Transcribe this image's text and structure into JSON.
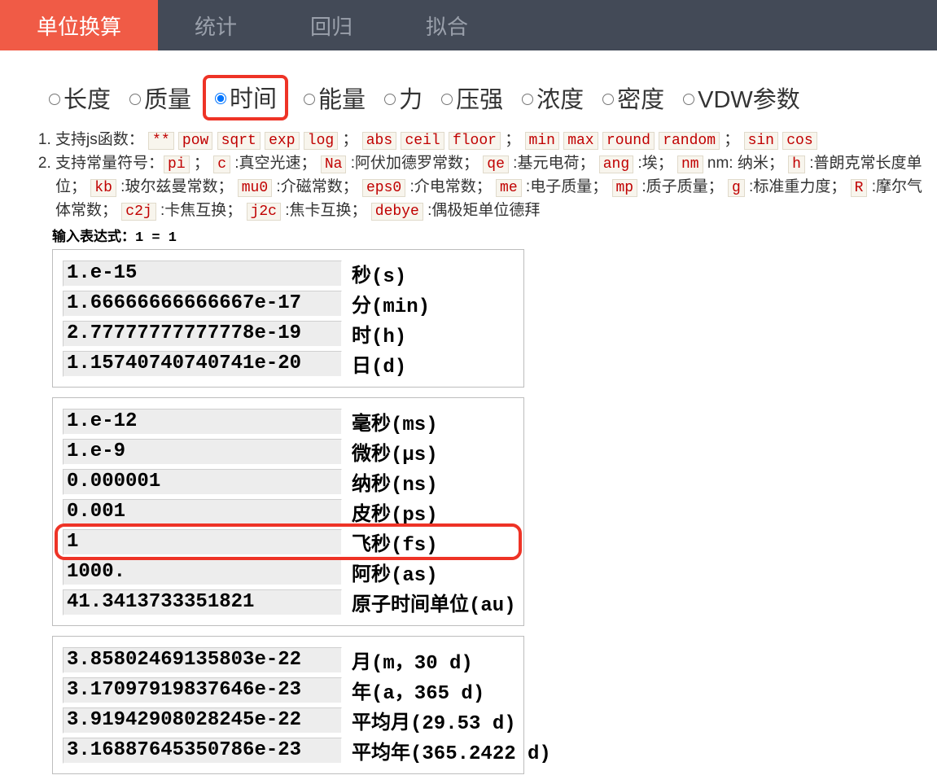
{
  "tabs": [
    {
      "label": "单位换算",
      "active": true
    },
    {
      "label": "统计",
      "active": false
    },
    {
      "label": "回归",
      "active": false
    },
    {
      "label": "拟合",
      "active": false
    }
  ],
  "categories": [
    {
      "label": "长度"
    },
    {
      "label": "质量"
    },
    {
      "label": "时间",
      "selected": true,
      "highlight": true
    },
    {
      "label": "能量"
    },
    {
      "label": "力"
    },
    {
      "label": "压强"
    },
    {
      "label": "浓度"
    },
    {
      "label": "密度"
    },
    {
      "label": "VDW参数"
    }
  ],
  "note1_prefix": "支持js函数：",
  "note1_funcs_a": [
    "**",
    "pow",
    "sqrt",
    "exp",
    "log"
  ],
  "note1_funcs_b": [
    "abs",
    "ceil",
    "floor"
  ],
  "note1_funcs_c": [
    "min",
    "max",
    "round",
    "random"
  ],
  "note1_funcs_d": [
    "sin",
    "cos"
  ],
  "note2_prefix": "支持常量符号：",
  "note2_items": [
    {
      "code": "pi",
      "text": "；"
    },
    {
      "code": "c",
      "text": ":真空光速；"
    },
    {
      "code": "Na",
      "text": ":阿伏加德罗常数；"
    },
    {
      "code": "qe",
      "text": ":基元电荷；"
    },
    {
      "code": "ang",
      "text": ":埃；"
    },
    {
      "code": "nm",
      "text": "nm: 纳米；"
    },
    {
      "code": "h",
      "text": ":普朗克常长度单位；"
    },
    {
      "code": "kb",
      "text": ":玻尔兹曼常数；"
    },
    {
      "code": "mu0",
      "text": ":介磁常数；"
    },
    {
      "code": "eps0",
      "text": ":介电常数；"
    },
    {
      "code": "me",
      "text": ":电子质量；"
    },
    {
      "code": "mp",
      "text": ":质子质量；"
    },
    {
      "code": "g",
      "text": ":标准重力度；"
    },
    {
      "code": "R",
      "text": ":摩尔气体常数；"
    },
    {
      "code": "c2j",
      "text": ":卡焦互换；"
    },
    {
      "code": "j2c",
      "text": ":焦卡互换；"
    },
    {
      "code": "debye",
      "text": ":偶极矩单位德拜"
    }
  ],
  "expr_label": "输入表达式：",
  "expr_value": "1 = 1",
  "groups": [
    [
      {
        "val": "1.e-15",
        "unit": "秒(s)"
      },
      {
        "val": "1.66666666666667e-17",
        "unit": "分(min)"
      },
      {
        "val": "2.77777777777778e-19",
        "unit": "时(h)"
      },
      {
        "val": "1.15740740740741e-20",
        "unit": "日(d)"
      }
    ],
    [
      {
        "val": "1.e-12",
        "unit": "毫秒(ms)"
      },
      {
        "val": "1.e-9",
        "unit": "微秒(µs)"
      },
      {
        "val": "0.000001",
        "unit": "纳秒(ns)"
      },
      {
        "val": "0.001",
        "unit": "皮秒(ps)"
      },
      {
        "val": "1",
        "unit": "飞秒(fs)",
        "highlight": true
      },
      {
        "val": "1000.",
        "unit": "阿秒(as)"
      },
      {
        "val": "41.3413733351821",
        "unit": "原子时间单位(au)"
      }
    ],
    [
      {
        "val": "3.85802469135803e-22",
        "unit": "月(m，30 d)"
      },
      {
        "val": "3.17097919837646e-23",
        "unit": "年(a，365 d)"
      },
      {
        "val": "3.91942908028245e-22",
        "unit": "平均月(29.53 d)"
      },
      {
        "val": "3.16887645350786e-23",
        "unit": "平均年(365.2422 d)"
      }
    ]
  ]
}
